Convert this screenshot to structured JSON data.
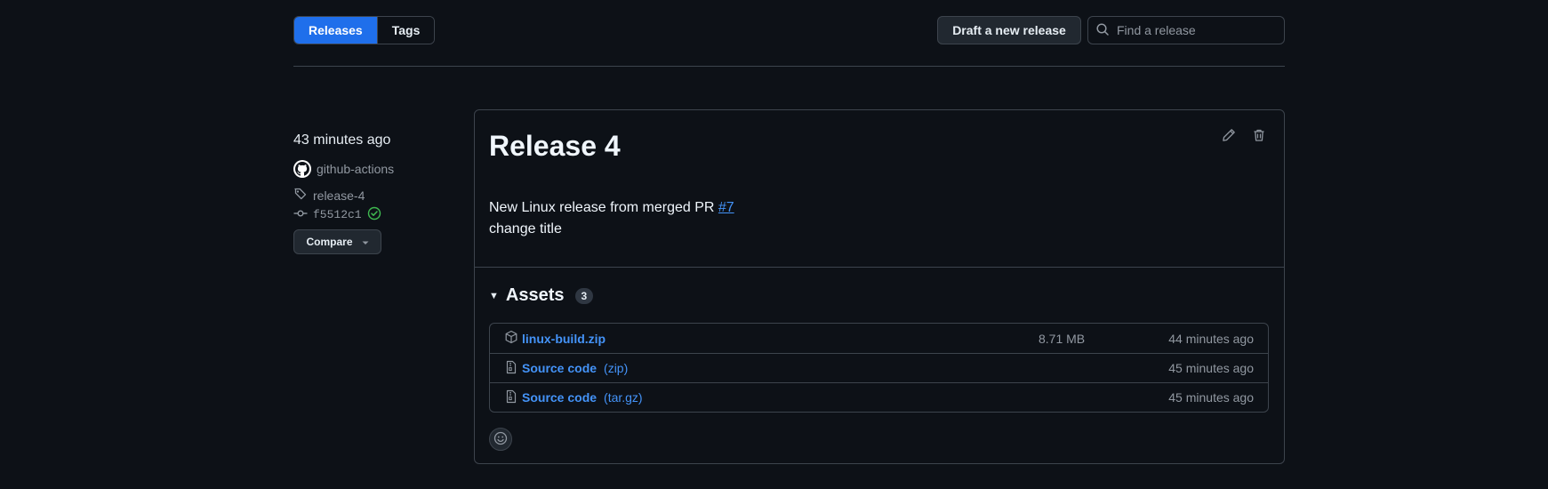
{
  "tabs": [
    {
      "label": "Releases",
      "active": true
    },
    {
      "label": "Tags",
      "active": false
    }
  ],
  "toolbar": {
    "draft_label": "Draft a new release",
    "search_placeholder": "Find a release"
  },
  "release": {
    "time": "43 minutes ago",
    "author": "github-actions",
    "tag": "release-4",
    "commit": "f5512c1",
    "compare_label": "Compare",
    "title": "Release 4",
    "body_prefix": "New Linux release from merged PR ",
    "pr_link": "#7",
    "body_line2": "change title",
    "assets_title": "Assets",
    "assets_count": "3",
    "assets": [
      {
        "name": "linux-build.zip",
        "ext": "",
        "size": "8.71 MB",
        "time": "44 minutes ago"
      },
      {
        "name": "Source code",
        "ext": "(zip)",
        "size": "",
        "time": "45 minutes ago"
      },
      {
        "name": "Source code",
        "ext": "(tar.gz)",
        "size": "",
        "time": "45 minutes ago"
      }
    ]
  },
  "colors": {
    "background": "#0d1117",
    "accent": "#1f6feb",
    "link": "#4493f8",
    "success": "#3fb950",
    "border": "#3d444d"
  }
}
